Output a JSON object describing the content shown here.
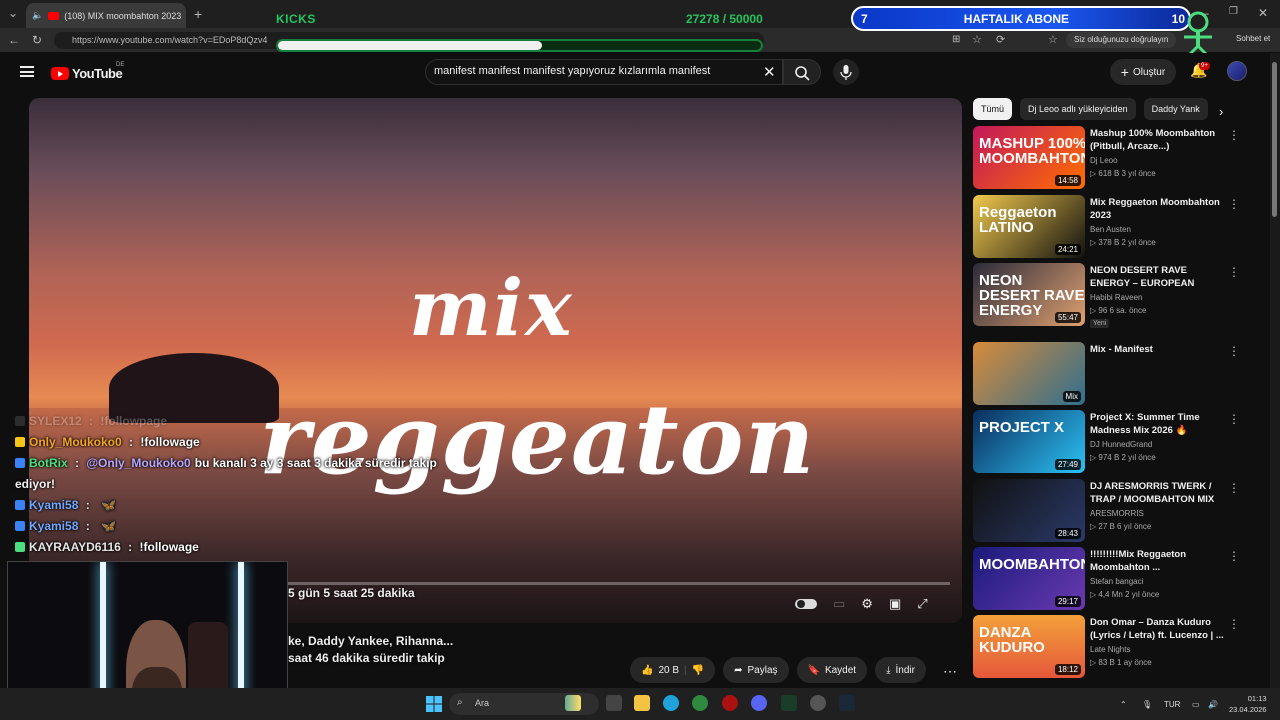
{
  "browser": {
    "tab_title": "(108) MIX moombahton 2023",
    "url": "https://www.youtube.com/watch?v=EDoP8dQzv4",
    "signin_prompt": "Siz olduğunuzu doğrulayın",
    "chat_button": "Sohbet et"
  },
  "overlay": {
    "kicks_label": "KICKS",
    "kicks_count": "27278 / 50000",
    "kicks_progress": 0.5456,
    "sub_current": "7",
    "sub_label": "HAFTALIK ABONE",
    "sub_max": "10"
  },
  "youtube": {
    "logo": "YouTube",
    "country": "DE",
    "search_query": "manifest manifest manifest yapıyoruz kızlarımla manifest",
    "create_label": "Oluştur",
    "notif_count": "9+"
  },
  "video": {
    "line1": "mix",
    "line2": "reggeaton"
  },
  "chat": [
    {
      "name": "SYLEX12",
      "sep": " : ",
      "msg": "!followpage",
      "faded": true
    },
    {
      "name": "Only_Moukoko0",
      "sep": " : ",
      "msg": "!followage",
      "faded": false,
      "cls": "n-orange"
    },
    {
      "name": "BotRix",
      "sep": " : ",
      "mention": "@Only_Moukoko0",
      "msg": "bu kanalı 3 ay 3 saat 3 dakika süredir takip",
      "faded": false,
      "cls": "n-green"
    },
    {
      "name": "",
      "sep": "",
      "msg": "ediyor!",
      "faded": false,
      "cls": "n-white"
    },
    {
      "name": "Kyami58",
      "sep": " : ",
      "msg": "",
      "faded": false,
      "cls": "n-blue"
    },
    {
      "name": "Kyami58",
      "sep": " : ",
      "msg": "",
      "faded": false,
      "cls": "n-blue"
    },
    {
      "name": "KAYRAAYD6116",
      "sep": " : ",
      "msg": "!followage",
      "faded": false,
      "cls": "n-white"
    }
  ],
  "overlap": {
    "timer": "5 gün 5 saat 25 dakika",
    "partial_title": "ke, Daddy Yankee, Rihanna...",
    "partial_follow": "saat 46 dakika süredir takip"
  },
  "actions": {
    "like_count": "20 B",
    "share": "Paylaş",
    "save": "Kaydet",
    "download": "İndir"
  },
  "chips": [
    "Tümü",
    "Dj Leoo adlı yükleyiciden",
    "Daddy Yank"
  ],
  "recommendations": [
    {
      "title": "Mashup 100% Moombahton (Pitbull, Arcaze...)",
      "channel": "Dj Leoo",
      "meta": "▷ 618 B  3 yıl önce",
      "duration": "14:58",
      "thumb": "MASHUP 100% MOOMBAHTON",
      "new": ""
    },
    {
      "title": "Mix Reggaeton Moombahton 2023",
      "channel": "Ben Austen",
      "meta": "▷ 378 B  2 yıl önce",
      "duration": "24:21",
      "thumb": "Reggaeton LATINO",
      "new": ""
    },
    {
      "title": "NEON DESERT RAVE ENERGY – EUROPEAN NIGHT QUEEN – ...",
      "channel": "Habibi Raveen",
      "meta": "▷ 96  6 sa. önce",
      "duration": "55:47",
      "thumb": "NEON DESERT RAVE ENERGY",
      "new": "Yeni"
    },
    {
      "title": "Mix - Manifest",
      "channel": "",
      "meta": "",
      "duration": "Mix",
      "thumb": "",
      "new": ""
    },
    {
      "title": "Project X: Summer Time Madness Mix 2026 🔥",
      "channel": "DJ HunnedGrand",
      "meta": "▷ 974 B  2 yıl önce",
      "duration": "27:49",
      "thumb": "PROJECT X",
      "new": ""
    },
    {
      "title": "DJ ARESMORRIS TWERK / TRAP / MOOMBAHTON MIX",
      "channel": "ARESMORRIS",
      "meta": "▷ 27 B  6 yıl önce",
      "duration": "28:43",
      "thumb": "",
      "new": ""
    },
    {
      "title": "!!!!!!!!!Mix Reggaeton Moombahton ...",
      "channel": "Stefan bangaci",
      "meta": "▷ 4,4 Mn  2 yıl önce",
      "duration": "29:17",
      "thumb": "MOOMBAHTON",
      "new": ""
    },
    {
      "title": "Don Omar – Danza Kuduro (Lyrics / Letra) ft. Lucenzo | ...",
      "channel": "Late Nights",
      "meta": "▷ 83 B  1 ay önce",
      "duration": "18:12",
      "thumb": "DANZA KUDURO",
      "new": ""
    }
  ],
  "taskbar": {
    "search": "Ara",
    "lang": "TUR",
    "time": "01:13",
    "date": "23.04.2026"
  },
  "colors": {
    "kick_green": "#22c55e",
    "sub_blue": "#1a56f0",
    "yt_red": "#ff0000"
  }
}
